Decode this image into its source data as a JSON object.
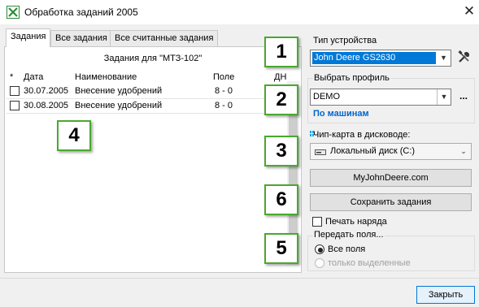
{
  "window": {
    "title": "Обработка заданий 2005",
    "close_label": "✕"
  },
  "tabs": [
    {
      "label": "Задания"
    },
    {
      "label": "Все задания"
    },
    {
      "label": "Все считанные задания"
    }
  ],
  "tasks": {
    "subtitle": "Задания для \"МТЗ-102\"",
    "headers": {
      "check": "*",
      "date": "Дата",
      "name": "Наименование",
      "field": "Поле",
      "days": "ДН"
    },
    "rows": [
      {
        "checked": false,
        "date": "30.07.2005",
        "name": "Внесение удобрений",
        "field": "8 - 0"
      },
      {
        "checked": false,
        "date": "30.08.2005",
        "name": "Внесение удобрений",
        "field": "8 - 0"
      }
    ]
  },
  "device": {
    "label": "Тип устройства",
    "value": "John Deere GS2630",
    "selected_color": "#0078d7"
  },
  "profile": {
    "label": "Выбрать профиль",
    "value": "DEMO",
    "more": "...",
    "link": "По машинам"
  },
  "chip": {
    "label": "Чип-карта в дисководе:",
    "value": "Локальный диск (C:)"
  },
  "buttons": {
    "myjohndeere": "MyJohnDeere.com",
    "save": "Сохранить задания",
    "close": "Закрыть"
  },
  "print": {
    "label": "Печать наряда",
    "checked": false
  },
  "transfer": {
    "legend": "Передать поля...",
    "options": [
      {
        "label": "Все поля",
        "selected": true,
        "enabled": true
      },
      {
        "label": "только выделенные",
        "selected": false,
        "enabled": false
      }
    ]
  },
  "callouts": [
    "1",
    "2",
    "3",
    "4",
    "5",
    "6"
  ],
  "colors": {
    "callout_border": "#4aa82f",
    "link": "#0066cc",
    "app_icon": "#2e8b3a"
  }
}
